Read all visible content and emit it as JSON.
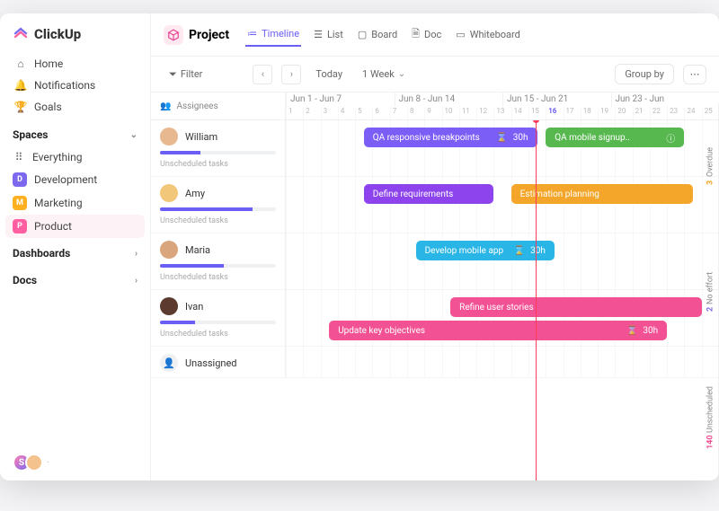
{
  "brand": "ClickUp",
  "nav": {
    "home": "Home",
    "notifications": "Notifications",
    "goals": "Goals"
  },
  "sections": {
    "spaces": "Spaces",
    "dashboards": "Dashboards",
    "docs": "Docs"
  },
  "spaces": [
    {
      "badge": "⠿",
      "label": "Everything",
      "color": "#888"
    },
    {
      "badge": "D",
      "label": "Development",
      "color": "#7b68ee"
    },
    {
      "badge": "M",
      "label": "Marketing",
      "color": "#ffb020"
    },
    {
      "badge": "P",
      "label": "Product",
      "color": "#ff5fa0"
    }
  ],
  "project": {
    "label": "Project"
  },
  "views": {
    "timeline": "Timeline",
    "list": "List",
    "board": "Board",
    "doc": "Doc",
    "whiteboard": "Whiteboard"
  },
  "toolbar": {
    "filter": "Filter",
    "today": "Today",
    "range": "1 Week",
    "group_by": "Group by"
  },
  "header": {
    "assignees": "Assignees",
    "weeks": [
      "Jun 1 - Jun 7",
      "Jun 8 - Jun 14",
      "Jun 15 - Jun 21",
      "Jun 23 - Jun"
    ],
    "days": [
      "1",
      "2",
      "3",
      "4",
      "5",
      "6",
      "7",
      "8",
      "9",
      "10",
      "11",
      "12",
      "13",
      "14",
      "15",
      "16",
      "17",
      "18",
      "19",
      "20",
      "21",
      "22",
      "23",
      "24",
      "25"
    ]
  },
  "rows": [
    {
      "name": "William",
      "progress": 35,
      "unscheduled": "Unscheduled tasks"
    },
    {
      "name": "Amy",
      "progress": 80,
      "unscheduled": "Unscheduled tasks"
    },
    {
      "name": "Maria",
      "progress": 55,
      "unscheduled": "Unscheduled tasks"
    },
    {
      "name": "Ivan",
      "progress": 30,
      "unscheduled": "Unscheduled tasks"
    },
    {
      "name": "Unassigned"
    }
  ],
  "tasks": {
    "qa_breakpoints": {
      "label": "QA responsive breakpoints",
      "hours": "30h"
    },
    "qa_mobile": {
      "label": "QA mobile signup.."
    },
    "define_req": {
      "label": "Define requirements"
    },
    "estimation": {
      "label": "Estimation planning"
    },
    "develop_mobile": {
      "label": "Develop mobile app",
      "hours": "30h"
    },
    "refine_stories": {
      "label": "Refine user stories"
    },
    "update_obj": {
      "label": "Update key objectives",
      "hours": "30h"
    }
  },
  "right": {
    "overdue_n": "3",
    "overdue": "Overdue",
    "noeffort_n": "2",
    "noeffort": "No effort",
    "unscheduled_n": "140",
    "unscheduled": "Unscheduled"
  },
  "colors": {
    "purple": "#7b5ef5",
    "green": "#57b84f",
    "violet": "#8e44ec",
    "orange": "#f4a62a",
    "cyan": "#29b6e6",
    "pink": "#f25193"
  }
}
